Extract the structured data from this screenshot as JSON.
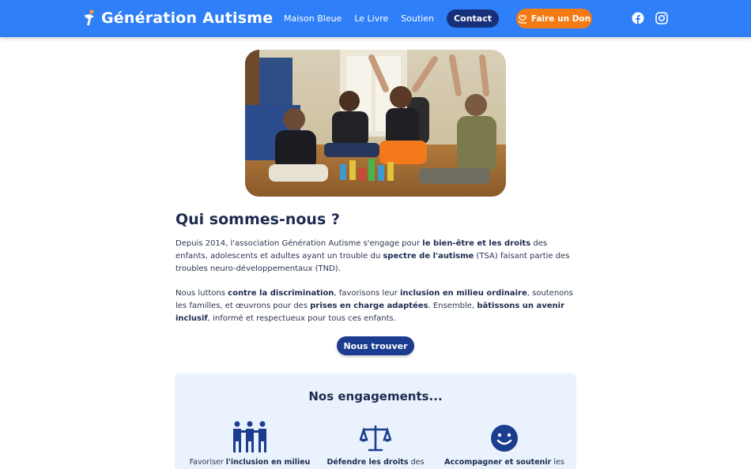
{
  "header": {
    "logo_title": "Génération Autisme",
    "nav": [
      "Maison Bleue",
      "Le Livre",
      "Soutien"
    ],
    "contact_label": "Contact",
    "donate_label": "Faire un Don"
  },
  "about": {
    "title": "Qui sommes-nous ?",
    "p1": {
      "a": "Depuis 2014, l'association Génération Autisme s'engage pour ",
      "b": "le bien-être et les droits",
      "c": " des enfants, adolescents et adultes ayant un trouble du ",
      "d": "spectre de l'autisme",
      "e": " (TSA) faisant partie des troubles neuro-développementaux (TND)."
    },
    "p2": {
      "a": "Nous luttons ",
      "b": "contre la discrimination",
      "c": ", favorisons leur ",
      "d": "inclusion en milieu ordinaire",
      "e": ", soutenons les familles, et œuvrons pour des ",
      "f": "prises en charge adaptées",
      "g": ". Ensemble, ",
      "h": "bâtissons un avenir inclusif",
      "i": ", informé et respectueux pour tous ces enfants."
    },
    "find_button": "Nous trouver"
  },
  "engagements": {
    "title": "Nos engagements...",
    "items": [
      {
        "pre": "Favoriser ",
        "bold": "l'inclusion en milieu",
        "post": "",
        "icon": "people-icon"
      },
      {
        "pre": "",
        "bold": "Défendre les droits",
        "post": " des",
        "icon": "scales-icon"
      },
      {
        "pre": "",
        "bold": "Accompagner et soutenir",
        "post": " les",
        "icon": "smiley-icon"
      }
    ]
  },
  "colors": {
    "header": "#2f7ff8",
    "contact_bg": "#17307a",
    "donate": "#f47b13",
    "primary_dark": "#1c3c8f",
    "engage_bg": "#eaf3fd"
  }
}
